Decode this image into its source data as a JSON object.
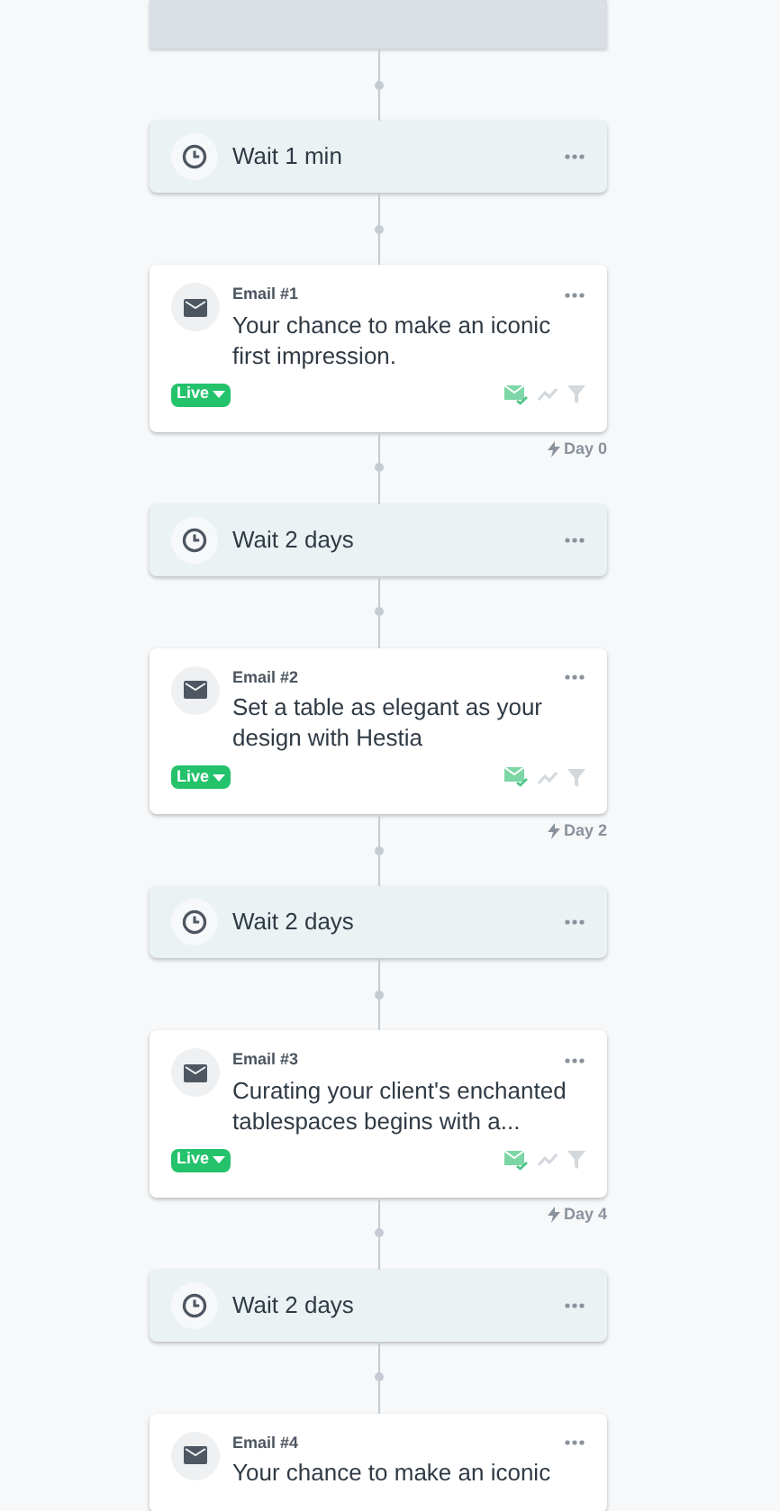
{
  "steps": [
    {
      "kind": "block"
    },
    {
      "kind": "wait",
      "label": "Wait 1 min"
    },
    {
      "kind": "email",
      "label": "Email #1",
      "subject": "Your chance to make an iconic first impression.",
      "status": "Live",
      "day": "Day 0"
    },
    {
      "kind": "wait",
      "label": "Wait 2 days"
    },
    {
      "kind": "email",
      "label": "Email #2",
      "subject": "Set a table as elegant as your design with Hestia",
      "status": "Live",
      "day": "Day 2"
    },
    {
      "kind": "wait",
      "label": "Wait 2 days"
    },
    {
      "kind": "email",
      "label": "Email #3",
      "subject": "Curating your client's enchanted tablespaces begins with a...",
      "status": "Live",
      "day": "Day 4"
    },
    {
      "kind": "wait",
      "label": "Wait 2 days"
    },
    {
      "kind": "email",
      "label": "Email #4",
      "subject": "Your chance to make an iconic"
    }
  ]
}
